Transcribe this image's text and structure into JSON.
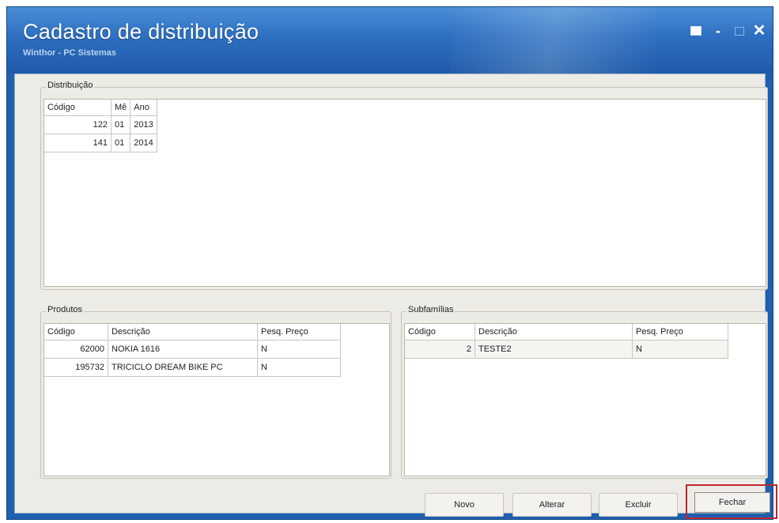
{
  "window": {
    "title": "Cadastro de distribuição",
    "subtitle": "Winthor - PC Sistemas",
    "controls": {
      "minimize": "-",
      "close": "✕"
    }
  },
  "distribuicao": {
    "legend": "Distribuição",
    "headers": [
      "Código",
      "Mê",
      "Ano"
    ],
    "rows": [
      [
        "122",
        "01",
        "2013"
      ],
      [
        "141",
        "01",
        "2014"
      ]
    ]
  },
  "produtos": {
    "legend": "Produtos",
    "headers": [
      "Código",
      "Descrição",
      "Pesq. Preço"
    ],
    "rows": [
      [
        "62000",
        "NOKIA 1616",
        "N"
      ],
      [
        "195732",
        "TRICICLO DREAM BIKE PC",
        "N"
      ]
    ]
  },
  "subfamilias": {
    "legend": "Subfamílias",
    "headers": [
      "Código",
      "Descrição",
      "Pesq. Preço"
    ],
    "rows": [
      [
        "2",
        "TESTE2",
        "N"
      ]
    ]
  },
  "buttons": {
    "novo": "Novo",
    "alterar": "Alterar",
    "excluir": "Excluir",
    "fechar": "Fechar"
  },
  "colors": {
    "titlebar": "#2d6fc0",
    "highlight": "#c0252c"
  }
}
